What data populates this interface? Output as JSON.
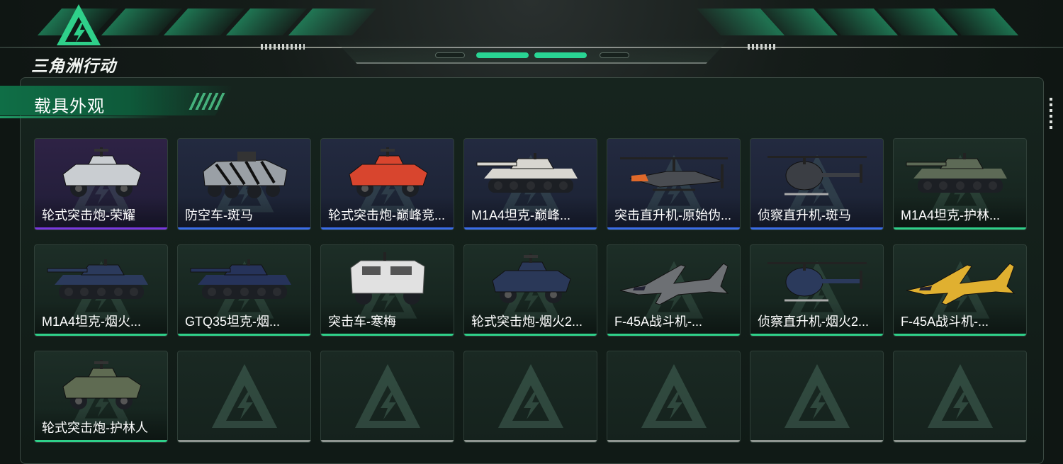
{
  "app": {
    "logo_text": "三角洲行动"
  },
  "section": {
    "title": "载具外观"
  },
  "colors": {
    "accent": "#2fd08a",
    "rarity_purple": "#7a38e0",
    "rarity_blue": "#3a6de8",
    "rarity_green": "#2fd08a",
    "empty": "#8f9691"
  },
  "items": [
    {
      "name": "轮式突击炮-荣耀",
      "rarity": "purple",
      "kind": "wheeled",
      "camo": "#c9cdd1"
    },
    {
      "name": "防空车-斑马",
      "rarity": "blue",
      "kind": "apc",
      "camo": "#9aa0a6"
    },
    {
      "name": "轮式突击炮-巅峰竞...",
      "rarity": "blue",
      "kind": "wheeled",
      "camo": "#d8452e"
    },
    {
      "name": "M1A4坦克-巅峰...",
      "rarity": "blue",
      "kind": "tank",
      "camo": "#d8d6d0"
    },
    {
      "name": "突击直升机-原始伪...",
      "rarity": "blue",
      "kind": "heli",
      "camo": "#4a4d52"
    },
    {
      "name": "侦察直升机-斑马",
      "rarity": "blue",
      "kind": "scout",
      "camo": "#3b3e44"
    },
    {
      "name": "M1A4坦克-护林...",
      "rarity": "green",
      "kind": "tank",
      "camo": "#5d6a56"
    },
    {
      "name": "M1A4坦克-烟火...",
      "rarity": "green",
      "kind": "tank",
      "camo": "#2b3a5c"
    },
    {
      "name": "GTQ35坦克-烟...",
      "rarity": "green",
      "kind": "tank",
      "camo": "#26335a"
    },
    {
      "name": "突击车-寒梅",
      "rarity": "green",
      "kind": "truck",
      "camo": "#e1e1e1"
    },
    {
      "name": "轮式突击炮-烟火2...",
      "rarity": "green",
      "kind": "wheeled",
      "camo": "#2a3858"
    },
    {
      "name": "F-45A战斗机-...",
      "rarity": "green",
      "kind": "jet",
      "camo": "#6d7074"
    },
    {
      "name": "侦察直升机-烟火2...",
      "rarity": "green",
      "kind": "scout",
      "camo": "#2b3a5c"
    },
    {
      "name": "F-45A战斗机-...",
      "rarity": "green",
      "kind": "jet",
      "camo": "#e0b030"
    },
    {
      "name": "轮式突击炮-护林人",
      "rarity": "green",
      "kind": "wheeled",
      "camo": "#5f6b52"
    },
    {
      "name": "",
      "rarity": "empty",
      "kind": "empty"
    },
    {
      "name": "",
      "rarity": "empty",
      "kind": "empty"
    },
    {
      "name": "",
      "rarity": "empty",
      "kind": "empty"
    },
    {
      "name": "",
      "rarity": "empty",
      "kind": "empty"
    },
    {
      "name": "",
      "rarity": "empty",
      "kind": "empty"
    },
    {
      "name": "",
      "rarity": "empty",
      "kind": "empty"
    }
  ]
}
